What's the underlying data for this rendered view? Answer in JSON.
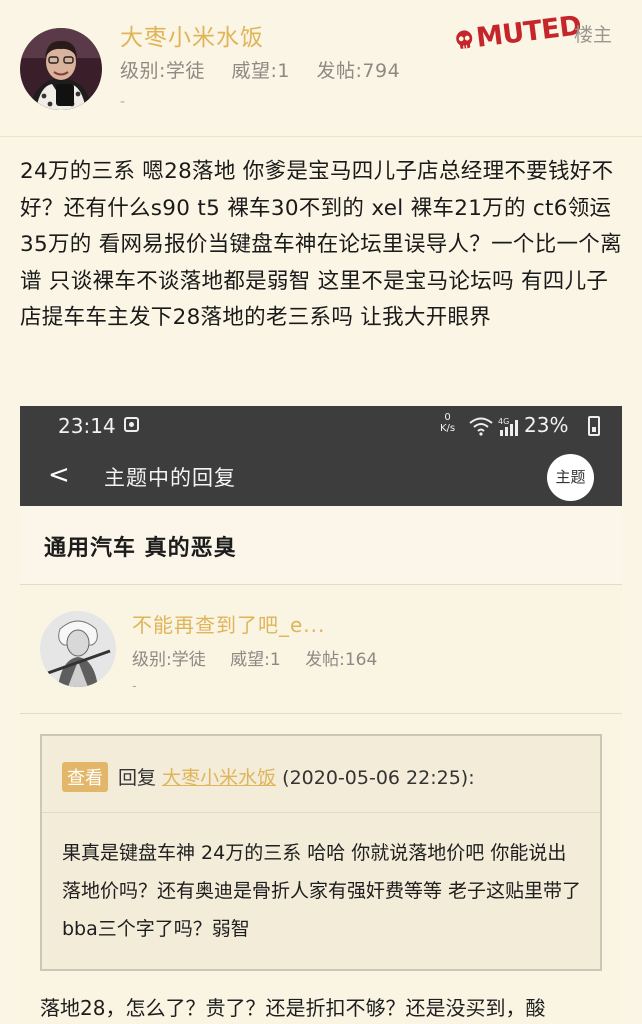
{
  "post": {
    "author": "大枣小米水饭",
    "level": "级别:学徒",
    "reputation": "威望:1",
    "posts": "发帖:794",
    "dash": "-",
    "muted_stamp": "MUTED",
    "op_label": "楼主",
    "content": "24万的三系 嗯28落地 你爹是宝马四儿子店总经理不要钱好不好？还有什么s90 t5 裸车30不到的 xel 裸车21万的 ct6领运35万的 看网易报价当键盘车神在论坛里误导人？一个比一个离谱 只谈裸车不谈落地都是弱智 这里不是宝马论坛吗 有四儿子店提车车主发下28落地的老三系吗 让我大开眼界"
  },
  "screenshot": {
    "status": {
      "time": "23:14",
      "speed_value": "0",
      "speed_unit": "K/s",
      "network": "4G",
      "battery": "23%"
    },
    "nav": {
      "back": "<",
      "title": "主题中的回复",
      "topic_button": "主题"
    },
    "thread_title": "通用汽车 真的恶臭",
    "reply": {
      "author": "不能再查到了吧_e...",
      "level": "级别:学徒",
      "reputation": "威望:1",
      "posts": "发帖:164",
      "dash": "-"
    },
    "quote": {
      "view_button": "查看",
      "reply_word": "回复",
      "quoted_user": "大枣小米水饭",
      "timestamp": "(2020-05-06 22:25):",
      "text": "果真是键盘车神 24万的三系 哈哈 你就说落地价吧 你能说出落地价吗？还有奥迪是骨折人家有强奸费等等 老子这贴里带了bba三个字了吗？弱智"
    },
    "bottom_text": "落地28，怎么了？贵了？还是折扣不够？还是没买到，酸"
  }
}
